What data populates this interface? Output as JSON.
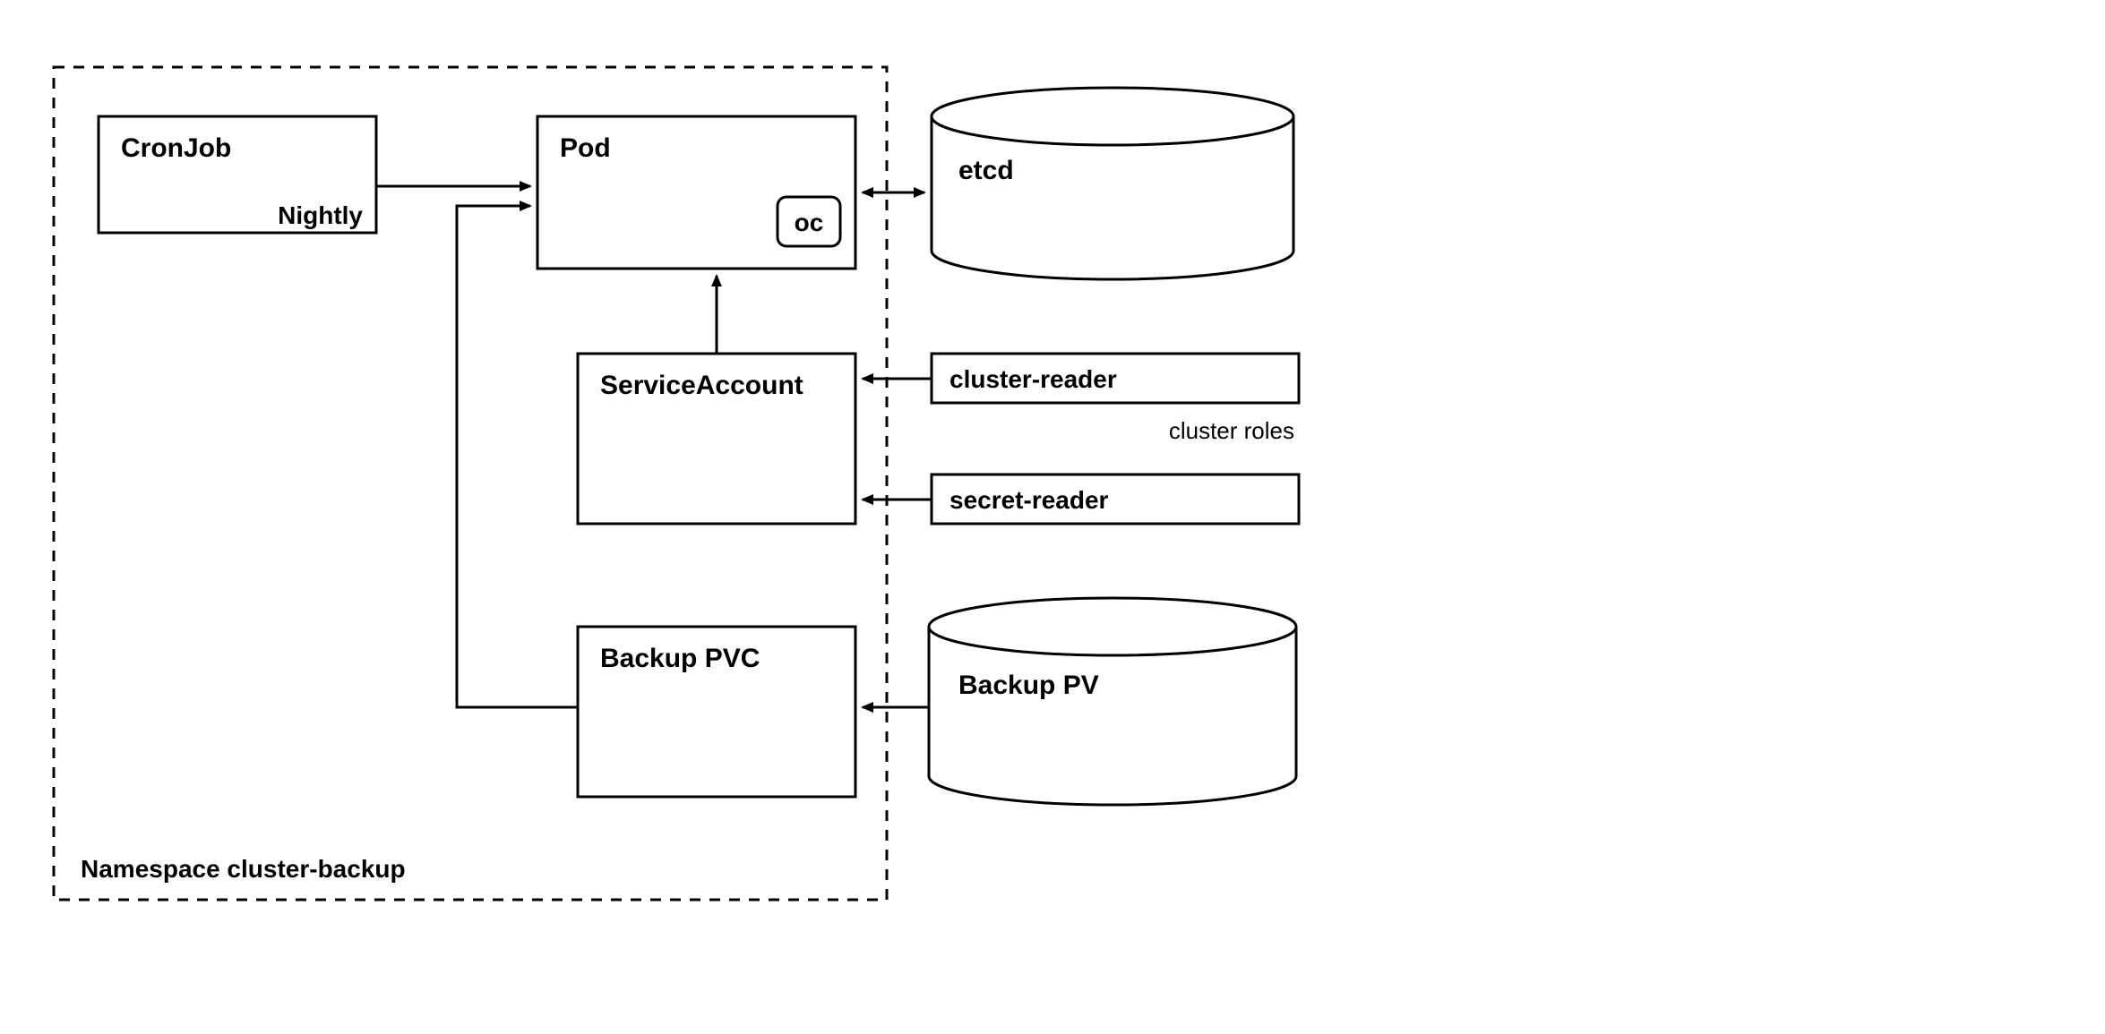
{
  "namespace": {
    "label": "Namespace cluster-backup"
  },
  "cronjob": {
    "title": "CronJob",
    "schedule": "Nightly"
  },
  "pod": {
    "title": "Pod",
    "tool": "oc"
  },
  "serviceaccount": {
    "title": "ServiceAccount"
  },
  "backuppvc": {
    "title": "Backup PVC"
  },
  "etcd": {
    "title": "etcd"
  },
  "roles": {
    "cluster_reader": "cluster-reader",
    "secret_reader": "secret-reader",
    "group_label": "cluster roles"
  },
  "backuppv": {
    "title": "Backup PV"
  }
}
